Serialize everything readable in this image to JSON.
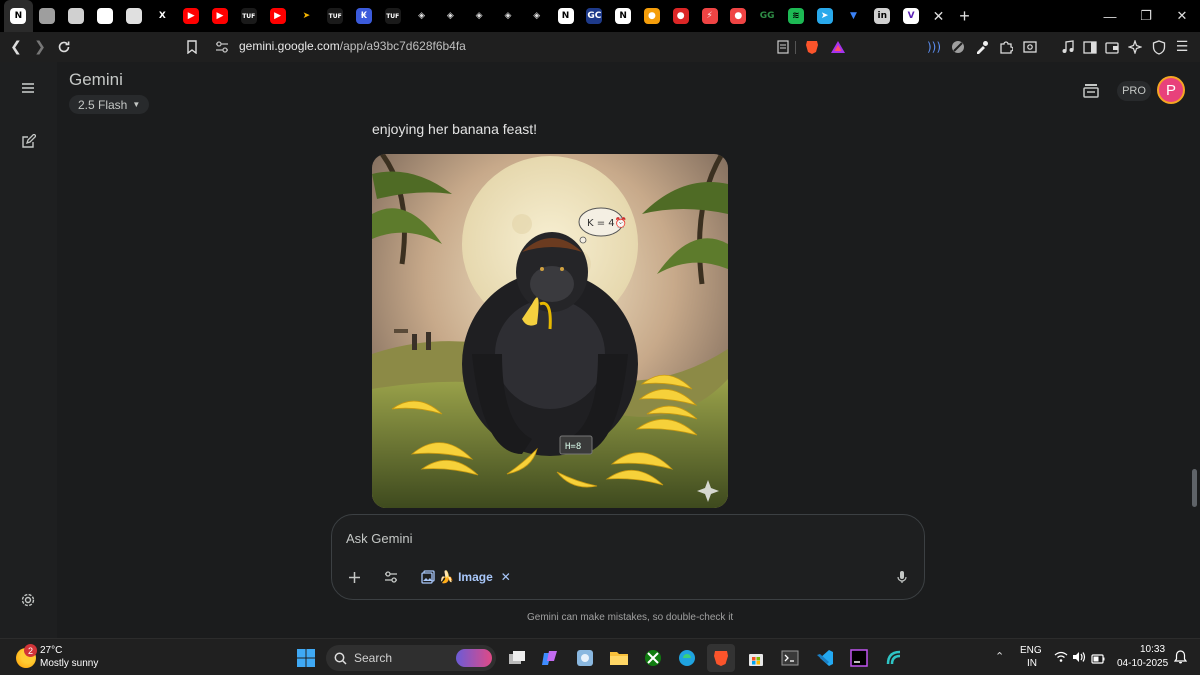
{
  "browser": {
    "tabs": [
      {
        "icon": "notion-icon",
        "label": "N",
        "color": "#ffffff",
        "fg": "#000000",
        "active": true
      },
      {
        "icon": "openai-icon",
        "label": "",
        "color": "#9e9e9e",
        "fg": "#000000"
      },
      {
        "icon": "globe-icon",
        "label": "",
        "color": "#d0d0d0",
        "fg": "#000000"
      },
      {
        "icon": "openai-icon",
        "label": "",
        "color": "#ffffff",
        "fg": "#000000"
      },
      {
        "icon": "grid-icon",
        "label": "",
        "color": "#e0e0e0",
        "fg": "#000000"
      },
      {
        "icon": "x-icon",
        "label": "X",
        "color": "#000000",
        "fg": "#ffffff"
      },
      {
        "icon": "youtube-icon",
        "label": "▶",
        "color": "#ff0000",
        "fg": "#ffffff"
      },
      {
        "icon": "youtube-icon",
        "label": "▶",
        "color": "#ff0000",
        "fg": "#ffffff"
      },
      {
        "icon": "tuf-icon",
        "label": "TUF",
        "color": "#1a1a1a",
        "fg": "#ffffff"
      },
      {
        "icon": "youtube-icon",
        "label": "▶",
        "color": "#ff0000",
        "fg": "#ffffff"
      },
      {
        "icon": "arrow-icon",
        "label": "➤",
        "color": "#000000",
        "fg": "#f5b400"
      },
      {
        "icon": "tuf-icon",
        "label": "TUF",
        "color": "#1a1a1a",
        "fg": "#ffffff"
      },
      {
        "icon": "chat-icon",
        "label": "₭",
        "color": "#3b5bdb",
        "fg": "#ffffff"
      },
      {
        "icon": "tuf-icon",
        "label": "TUF",
        "color": "#1a1a1a",
        "fg": "#ffffff"
      },
      {
        "icon": "git-icon",
        "label": "◈",
        "color": "#000000",
        "fg": "#e0e0e0"
      },
      {
        "icon": "git-icon",
        "label": "◈",
        "color": "#000000",
        "fg": "#e0e0e0"
      },
      {
        "icon": "git-icon",
        "label": "◈",
        "color": "#000000",
        "fg": "#e0e0e0"
      },
      {
        "icon": "git-icon",
        "label": "◈",
        "color": "#000000",
        "fg": "#e0e0e0"
      },
      {
        "icon": "git-icon",
        "label": "◈",
        "color": "#000000",
        "fg": "#e0e0e0"
      },
      {
        "icon": "notion-icon",
        "label": "N",
        "color": "#ffffff",
        "fg": "#000000"
      },
      {
        "icon": "gc-icon",
        "label": "GC",
        "color": "#1e3a8a",
        "fg": "#ffffff"
      },
      {
        "icon": "notion-icon",
        "label": "N",
        "color": "#ffffff",
        "fg": "#000000"
      },
      {
        "icon": "orange-icon",
        "label": "●",
        "color": "#f59e0b",
        "fg": "#ffffff"
      },
      {
        "icon": "red-icon",
        "label": "●",
        "color": "#dc2626",
        "fg": "#ffffff"
      },
      {
        "icon": "bolt-icon",
        "label": "⚡",
        "color": "#ef4444",
        "fg": "#ffffff"
      },
      {
        "icon": "circle-icon",
        "label": "●",
        "color": "#ef4444",
        "fg": "#ffffff"
      },
      {
        "icon": "gfg-icon",
        "label": "GG",
        "color": "#000000",
        "fg": "#2f8d46"
      },
      {
        "icon": "spotify-icon",
        "label": "≋",
        "color": "#1db954",
        "fg": "#000000"
      },
      {
        "icon": "telegram-icon",
        "label": "➤",
        "color": "#29a9eb",
        "fg": "#ffffff"
      },
      {
        "icon": "bird-icon",
        "label": "▼",
        "color": "#000000",
        "fg": "#3b82f6"
      },
      {
        "icon": "linkedin-icon",
        "label": "in",
        "color": "#d0d0d0",
        "fg": "#000000"
      },
      {
        "icon": "v-icon",
        "label": "V",
        "color": "#ffffff",
        "fg": "#5b21b6"
      }
    ],
    "address": {
      "host": "gemini.google.com",
      "path": "/app/a93bc7d628f6b4fa"
    }
  },
  "app": {
    "title": "Gemini",
    "model_label": "2.5 Flash",
    "pro_label": "PRO",
    "avatar_letter": "P",
    "response_text": "enjoying her banana feast!",
    "image": {
      "thought_bubble_text": "K = 4⏰",
      "clock_text": "H=8"
    },
    "composer": {
      "placeholder": "Ask Gemini",
      "chip_emoji": "🍌",
      "chip_label": "Image",
      "chip_close": "✕"
    },
    "disclaimer": "Gemini can make mistakes, so double-check it"
  },
  "taskbar": {
    "weather": {
      "badge": "2",
      "temp": "27°C",
      "condition": "Mostly sunny"
    },
    "search_label": "Search",
    "lang": "ENG",
    "region": "IN",
    "time": "10:33",
    "date": "04-10-2025"
  },
  "colors": {
    "accent": "#a8c7fa",
    "avatar_bg": "#e8417b"
  }
}
